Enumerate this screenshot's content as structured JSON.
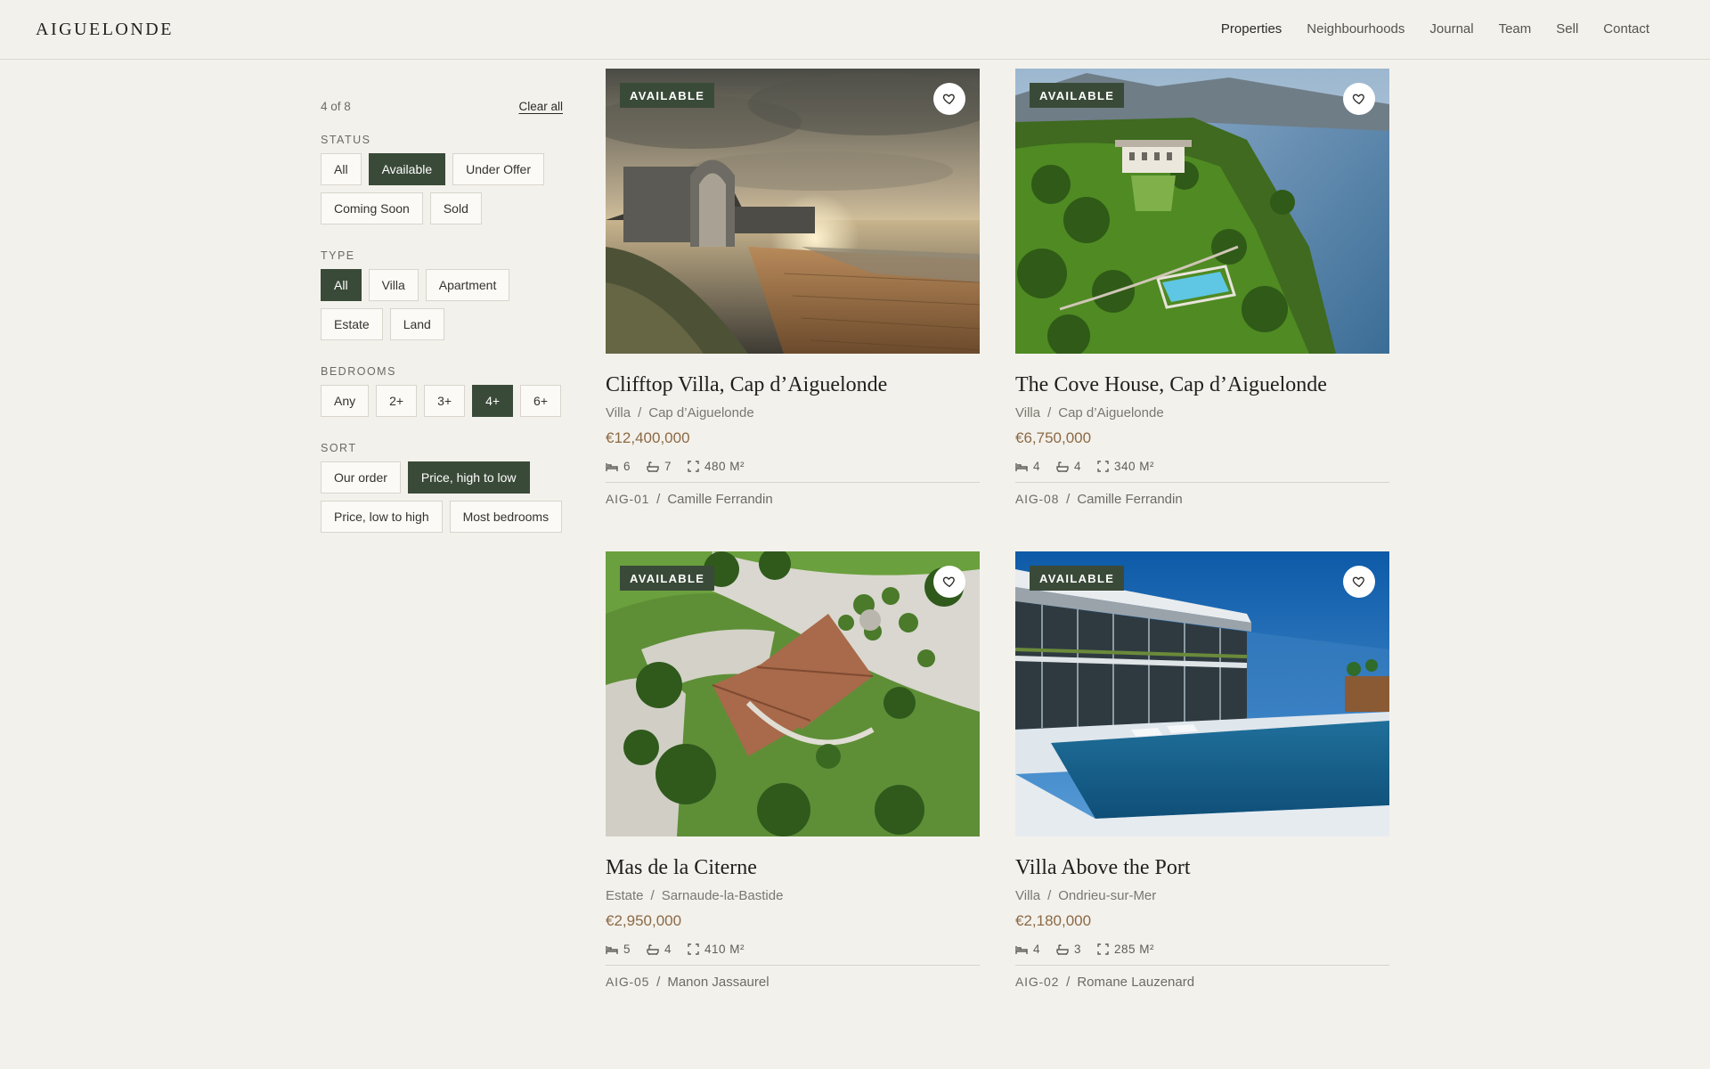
{
  "brand": "AIGUELONDE",
  "nav": [
    {
      "label": "Properties"
    },
    {
      "label": "Neighbourhoods"
    },
    {
      "label": "Journal"
    },
    {
      "label": "Team"
    },
    {
      "label": "Sell"
    },
    {
      "label": "Contact"
    }
  ],
  "filters": {
    "count": "4 of 8",
    "clear_label": "Clear all",
    "status": {
      "label": "STATUS",
      "options": [
        "All",
        "Available",
        "Under Offer",
        "Coming Soon",
        "Sold"
      ],
      "selected": "Available"
    },
    "type": {
      "label": "TYPE",
      "options": [
        "All",
        "Villa",
        "Apartment",
        "Estate",
        "Land"
      ],
      "selected": "All"
    },
    "bedrooms": {
      "label": "BEDROOMS",
      "options": [
        "Any",
        "2+",
        "3+",
        "4+",
        "6+"
      ],
      "selected": "4+"
    },
    "sort": {
      "label": "SORT",
      "options": [
        "Our order",
        "Price, high to low",
        "Price, low to high",
        "Most bedrooms"
      ],
      "selected": "Price, high to low"
    }
  },
  "listings": [
    {
      "badge": "AVAILABLE",
      "title": "Clifftop Villa, Cap d’Aiguelonde",
      "type": "Villa",
      "location": "Cap d’Aiguelonde",
      "price": "€12,400,000",
      "beds": "6",
      "baths": "7",
      "area": "480 M²",
      "ref": "AIG-01",
      "agent": "Camille Ferrandin",
      "image": "clifftop-villa-sunset-photo"
    },
    {
      "badge": "AVAILABLE",
      "title": "The Cove House, Cap d’Aiguelonde",
      "type": "Villa",
      "location": "Cap d’Aiguelonde",
      "price": "€6,750,000",
      "beds": "4",
      "baths": "4",
      "area": "340 M²",
      "ref": "AIG-08",
      "agent": "Camille Ferrandin",
      "image": "coastal-estate-aerial-photo"
    },
    {
      "badge": "AVAILABLE",
      "title": "Mas de la Citerne",
      "type": "Estate",
      "location": "Sarnaude-la-Bastide",
      "price": "€2,950,000",
      "beds": "5",
      "baths": "4",
      "area": "410 M²",
      "ref": "AIG-05",
      "agent": "Manon Jassaurel",
      "image": "estate-garden-aerial-photo"
    },
    {
      "badge": "AVAILABLE",
      "title": "Villa Above the Port",
      "type": "Villa",
      "location": "Ondrieu-sur-Mer",
      "price": "€2,180,000",
      "beds": "4",
      "baths": "3",
      "area": "285 M²",
      "ref": "AIG-02",
      "agent": "Romane Lauzenard",
      "image": "modern-villa-pool-photo"
    }
  ]
}
